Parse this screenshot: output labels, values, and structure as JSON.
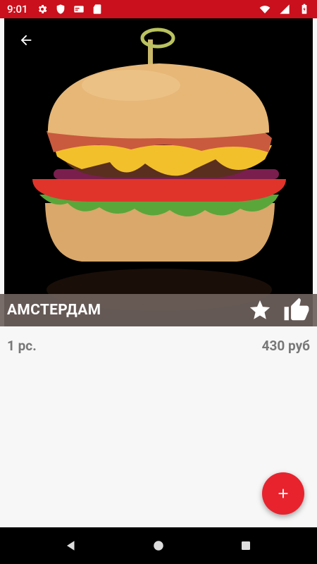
{
  "status_bar": {
    "time": "9:01",
    "left_icons": [
      "settings-icon",
      "shield-icon",
      "card-icon",
      "sd-card-icon"
    ],
    "right_icons": [
      "wifi-icon",
      "signal-icon",
      "battery-icon"
    ],
    "color": "#c9101c"
  },
  "product": {
    "name": "АМСТЕРДАМ",
    "quantity": "1 рс.",
    "price": "430 руб",
    "image": "burger-photo"
  },
  "actions": {
    "back": "arrow-back-icon",
    "favorite": "star-icon",
    "like": "thumb-up-icon",
    "add": "plus-icon"
  },
  "navigation": {
    "buttons": [
      "back-triangle-icon",
      "home-circle-icon",
      "recents-square-icon"
    ]
  },
  "colors": {
    "accent": "#e8232e",
    "title_bar": "#6e615c"
  }
}
